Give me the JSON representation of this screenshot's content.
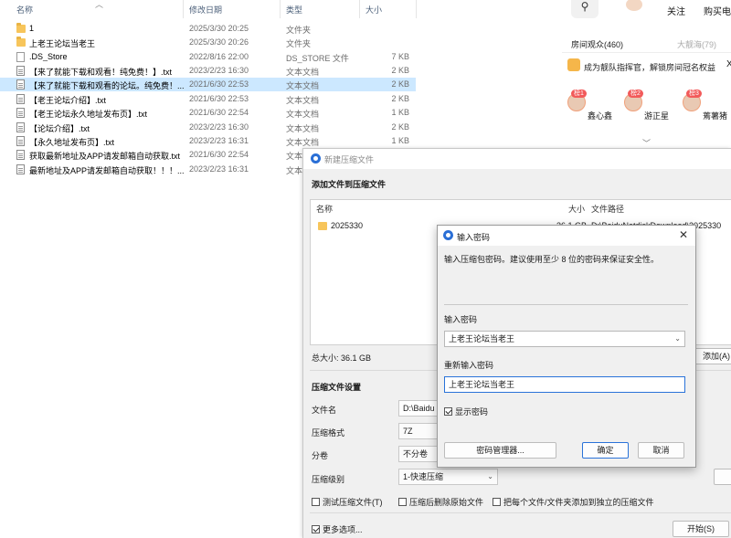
{
  "explorer": {
    "headers": {
      "name": "名称",
      "date": "修改日期",
      "type": "类型",
      "size": "大小"
    },
    "rows": [
      {
        "icon": "folder",
        "name": "1",
        "date": "2025/3/30 20:25",
        "type": "文件夹",
        "size": ""
      },
      {
        "icon": "folder",
        "name": "上老王论坛当老王",
        "date": "2025/3/30 20:26",
        "type": "文件夹",
        "size": ""
      },
      {
        "icon": "blank",
        "name": ".DS_Store",
        "date": "2022/8/16 22:00",
        "type": "DS_STORE 文件",
        "size": "7 KB"
      },
      {
        "icon": "file",
        "name": "【来了就能下载和观看！纯免费！】.txt",
        "date": "2023/2/23 16:30",
        "type": "文本文档",
        "size": "2 KB"
      },
      {
        "icon": "file",
        "name": "【来了就能下载和观看的论坛。纯免费！...",
        "date": "2021/6/30 22:53",
        "type": "文本文档",
        "size": "2 KB",
        "selected": true
      },
      {
        "icon": "file",
        "name": "【老王论坛介绍】.txt",
        "date": "2021/6/30 22:53",
        "type": "文本文档",
        "size": "2 KB"
      },
      {
        "icon": "file",
        "name": "【老王论坛永久地址发布页】.txt",
        "date": "2021/6/30 22:54",
        "type": "文本文档",
        "size": "1 KB"
      },
      {
        "icon": "file",
        "name": "【论坛介绍】.txt",
        "date": "2023/2/23 16:30",
        "type": "文本文档",
        "size": "2 KB"
      },
      {
        "icon": "file",
        "name": "【永久地址发布页】.txt",
        "date": "2023/2/23 16:31",
        "type": "文本文档",
        "size": "1 KB"
      },
      {
        "icon": "file",
        "name": "获取最新地址及APP请发邮箱自动获取.txt",
        "date": "2021/6/30 22:54",
        "type": "文本",
        "size": ""
      },
      {
        "icon": "file",
        "name": "最新地址及APP请发邮箱自动获取！！！...",
        "date": "2023/2/23 16:31",
        "type": "文本",
        "size": ""
      }
    ]
  },
  "browser": {
    "follow": "关注",
    "buy": "购买电",
    "tab_viewers": "房间观众(460)",
    "tab_fans": "大靓海(79)",
    "banner": "成为靓队指挥官，解锁房间冠名权益",
    "banner_close": "X",
    "ranks": [
      {
        "badge": "榜1",
        "name": "鑫心鑫"
      },
      {
        "badge": "榜2",
        "name": "游正星"
      },
      {
        "badge": "榜3",
        "name": "蔫薯猪"
      }
    ],
    "chevron": "﹀"
  },
  "archive": {
    "title": "新建压缩文件",
    "add_section": "添加文件到压缩文件",
    "list_headers": {
      "name": "名称",
      "size": "大小",
      "path": "文件路径"
    },
    "list_rows": [
      {
        "name": "2025330",
        "size": "36.1 GB",
        "path": "D:\\BaiduNetdiskDownload\\2025330"
      }
    ],
    "total": "总大小: 36.1 GB",
    "add_button": "添加(A)",
    "settings_section": "压缩文件设置",
    "fields": {
      "filename_label": "文件名",
      "filename_value": "D:\\Baidu",
      "format_label": "压缩格式",
      "format_value": "7Z",
      "split_label": "分卷",
      "split_value": "不分卷",
      "level_label": "压缩级别",
      "level_value": "1-快速压缩"
    },
    "checks": {
      "test": "测试压缩文件(T)",
      "delete_src": "压缩后删除原始文件",
      "separate": "把每个文件/文件夹添加到独立的压缩文件"
    },
    "more_options": "更多选项...",
    "start_button": "开始(S)"
  },
  "password_dialog": {
    "title": "输入密码",
    "close": "✕",
    "hint": "输入压缩包密码。建议使用至少 8 位的密码来保证安全性。",
    "pwd_label": "输入密码",
    "pwd_value": "上老王论坛当老王",
    "repeat_label": "重新输入密码",
    "repeat_value": "上老王论坛当老王",
    "show_password": "显示密码",
    "manager_button": "密码管理器...",
    "ok_button": "确定",
    "cancel_button": "取消"
  }
}
